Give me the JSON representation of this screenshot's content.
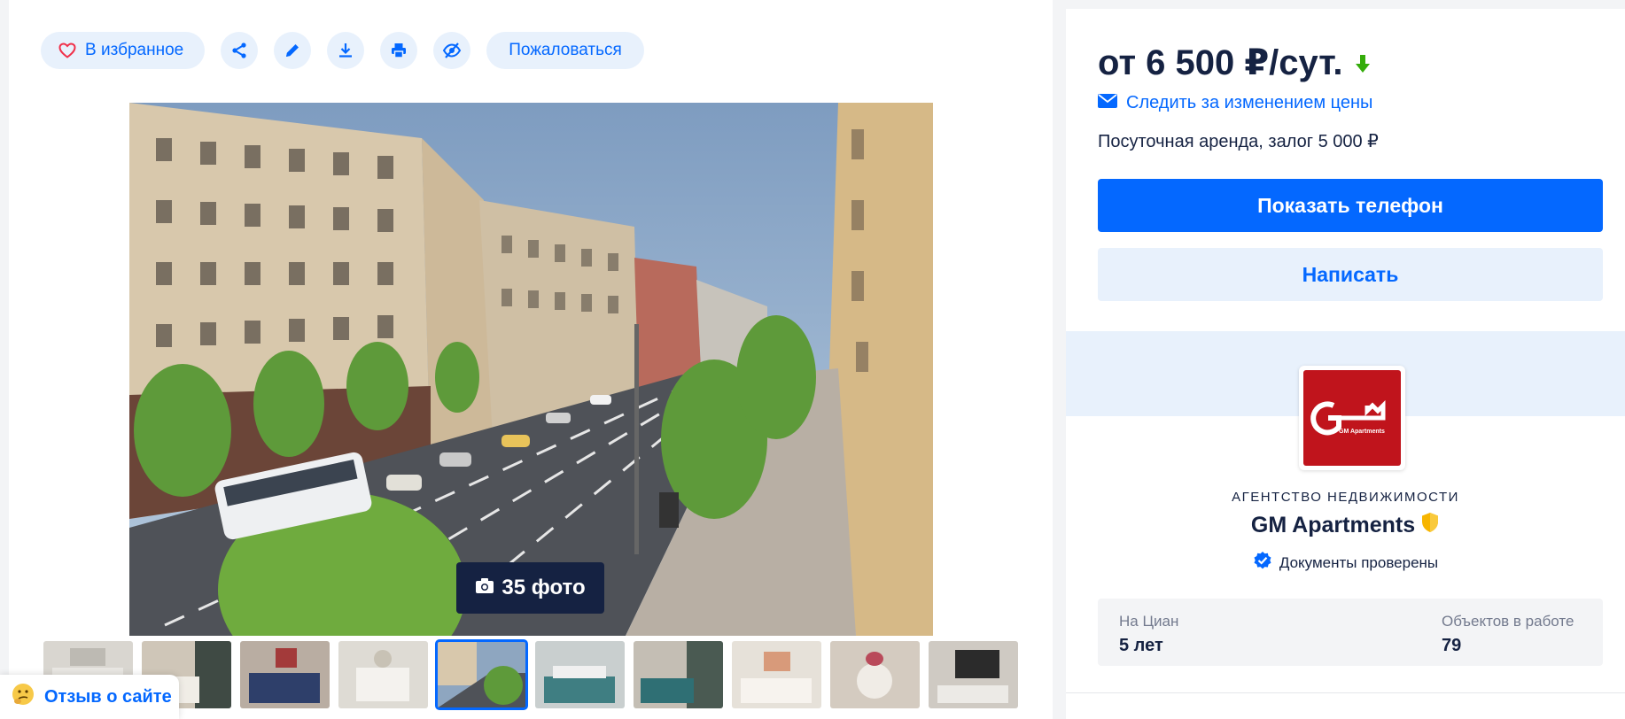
{
  "toolbar": {
    "favorite_label": "В избранное",
    "complain_label": "Пожаловаться",
    "icons": [
      "heart-icon",
      "share-icon",
      "pencil-icon",
      "download-icon",
      "print-icon",
      "hide-icon"
    ]
  },
  "gallery": {
    "photo_count": "35 фото",
    "thumbnail_count": 10,
    "active_thumbnail": 5
  },
  "feedback": {
    "label": "Отзыв о сайте"
  },
  "offer": {
    "price": "от 6 500 ₽/сут.",
    "watch_price_label": "Следить за изменением цены",
    "rent_terms": "Посуточная аренда, залог 5 000 ₽",
    "show_phone_label": "Показать телефон",
    "write_label": "Написать"
  },
  "agency": {
    "type": "АГЕНТСТВО НЕДВИЖИМОСТИ",
    "name": "GM Apartments",
    "logo_text": "GM Apartments",
    "docs_verified": "Документы проверены",
    "stats": [
      {
        "label": "На Циан",
        "value": "5 лет"
      },
      {
        "label": "Объектов в работе",
        "value": "79"
      }
    ]
  },
  "colors": {
    "accent": "#0468ff",
    "accent_light": "#e8f1fc",
    "text": "#152242",
    "logo_red": "#c0141c",
    "price_down": "#34ac0a"
  }
}
